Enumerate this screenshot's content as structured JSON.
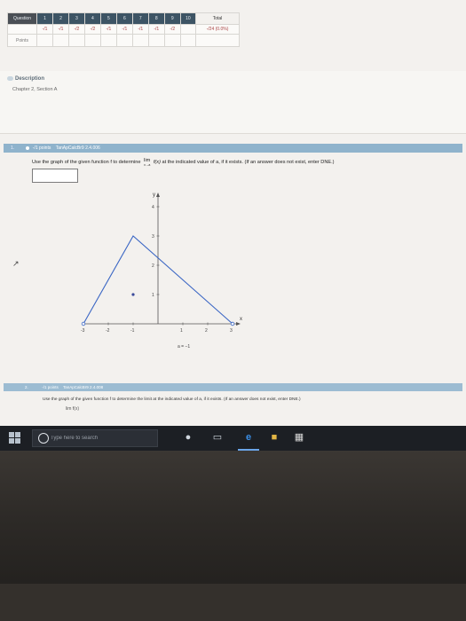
{
  "score_table": {
    "row_labels": [
      "Question",
      "Points"
    ],
    "question_numbers": [
      "1",
      "2",
      "3",
      "4",
      "5",
      "6",
      "7",
      "8",
      "9",
      "10"
    ],
    "total_label": "Total",
    "question_scores": [
      "-/1",
      "-/1",
      "-/2",
      "-/2",
      "-/1",
      "-/1",
      "-/1",
      "-/1",
      "-/2",
      ""
    ],
    "total_score": "-/24 (0.0%)"
  },
  "description": {
    "title": "Description",
    "subtitle": "Chapter 2, Section A"
  },
  "question1": {
    "number": "1.",
    "points_label": "-/1 points",
    "source": "TanApCalcBr9 2.4.006",
    "prompt_before": "Use the graph of the given function f to determine",
    "lim_text": "lim",
    "lim_func": "f(x)",
    "lim_sub": "x→a",
    "prompt_after": "at the indicated value of a, if it exists. (If an answer does not exist, enter DNE.)",
    "answer_value": "",
    "a_label": "a = −1",
    "graph": {
      "x_axis_label": "x",
      "y_axis_label": "y",
      "x_ticks": [
        "-3",
        "-2",
        "-1",
        "1",
        "2",
        "3"
      ],
      "y_ticks": [
        "1",
        "2",
        "3",
        "4"
      ],
      "colors": {
        "line": "#3a66c4",
        "axis": "#555555",
        "point": "#3a4a9a"
      }
    }
  },
  "question2": {
    "number": "2.",
    "points_label": "-/1 points",
    "source": "TanApCalcBr9 2.4.008",
    "prompt": "Use the graph of the given function f to determine the limit at the indicated value of a, if it exists. (If an answer does not exist, enter DNE.)",
    "lim_text": "lim f(x)"
  },
  "taskbar": {
    "search_placeholder": "Type here to search",
    "icons": [
      "windows-start-icon",
      "search-icon",
      "microphone-icon",
      "task-view-icon",
      "edge-browser-icon",
      "file-explorer-icon",
      "store-icon"
    ]
  }
}
